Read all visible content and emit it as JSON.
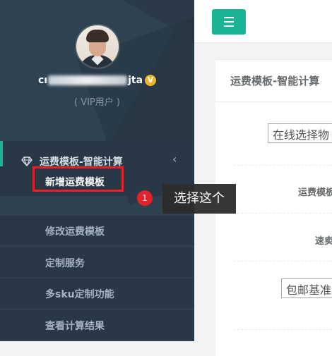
{
  "profile": {
    "username_start": "cı",
    "username_end": "jta",
    "verified_badge": "V",
    "role": "( VIP用户 )"
  },
  "sidebar": {
    "section_label": "运费模板-智能计算",
    "section_icon": "diamond-icon",
    "collapse_icon": "chevron-left-icon",
    "chevron": "‹",
    "items": [
      {
        "label": "新增运费模板"
      },
      {
        "label": "修改运费模板"
      },
      {
        "label": "定制服务"
      },
      {
        "label": "多sku定制功能"
      },
      {
        "label": "查看计算结果"
      }
    ]
  },
  "header": {
    "menu_icon": "hamburger-icon"
  },
  "panel": {
    "title": "运费模板-智能计算",
    "select1": "在线选择物",
    "label1": "运费模板",
    "label2": "速卖",
    "select2": "包邮基准"
  },
  "annotation": {
    "number": "1",
    "tooltip": "选择这个"
  },
  "colors": {
    "sidebar": "#2f4050",
    "accent": "#1ab394",
    "highlight": "#e7212a"
  }
}
